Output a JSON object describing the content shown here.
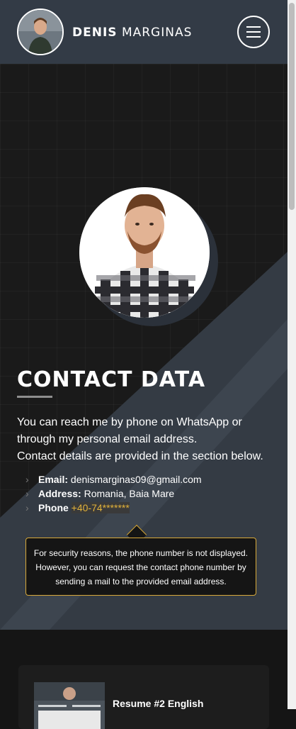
{
  "header": {
    "brand_first": "DENIS",
    "brand_last": "MARGINAS"
  },
  "hero": {
    "title": "CONTACT DATA",
    "intro": [
      "You can reach me by phone on WhatsApp or through my personal email address.",
      "Contact details are provided in the section below."
    ],
    "contacts": {
      "email_label": "Email:",
      "email_value": "denismarginas09@gmail.com",
      "address_label": "Address:",
      "address_value": "Romania, Baia Mare",
      "phone_label": "Phone",
      "phone_value": "+40-74*******"
    },
    "tooltip": "For security reasons, the phone number is not displayed. However, you can request the contact phone number by sending a mail to the provided email address."
  },
  "resume": {
    "title": "Resume #2 English"
  },
  "icons": {
    "menu": "hamburger-icon",
    "bullet": "chevron-right-icon"
  },
  "colors": {
    "header_bg": "#333b46",
    "accent": "#e0b13a",
    "page_bg": "#151515"
  }
}
